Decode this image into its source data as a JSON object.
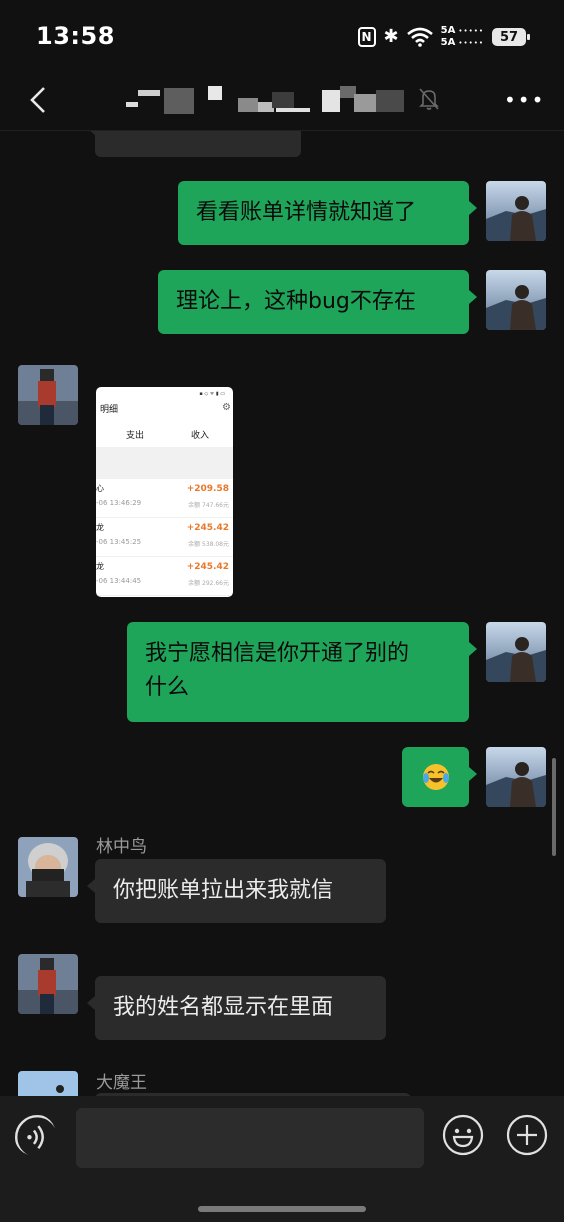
{
  "status_bar": {
    "time": "13:58",
    "network_label_top": "5A",
    "network_label_bottom": "5A",
    "battery": "57",
    "icons": [
      "nfc-icon",
      "bluetooth-icon",
      "wifi-icon",
      "signal-icon",
      "battery-icon"
    ]
  },
  "nav": {
    "back_icon": "chevron-left-icon",
    "mute_icon": "bell-off-icon",
    "more_icon": "more-horizontal-icon"
  },
  "messages": [
    {
      "from": "me",
      "text": "看看账单详情就知道了"
    },
    {
      "from": "me",
      "text": "理论上，这种bug不存在"
    },
    {
      "from": "other",
      "type": "image"
    },
    {
      "from": "me",
      "text_line1": "我宁愿相信是你开通了别的",
      "text_line2": "什么"
    },
    {
      "from": "me",
      "type": "emoji",
      "emoji": "laughing-with-tears-emoji"
    },
    {
      "from": "other",
      "sender": "林中鸟",
      "text": "你把账单拉出来我就信"
    },
    {
      "from": "other",
      "text": "我的姓名都显示在里面"
    },
    {
      "from": "other",
      "sender": "大魔王"
    }
  ],
  "screenshot_image": {
    "header": "明细",
    "tab_expense": "支出",
    "tab_income": "收入",
    "rows": [
      {
        "name": "心",
        "date": "-06 13:46:29",
        "amount": "+209.58",
        "balance": "余额 747.66元"
      },
      {
        "name": "龙",
        "date": "-06 13:45:25",
        "amount": "+245.42",
        "balance": "余额 538.08元"
      },
      {
        "name": "龙",
        "date": "-06 13:44:45",
        "amount": "+245.42",
        "balance": "余额 292.66元"
      }
    ]
  },
  "input_bar": {
    "placeholder": "",
    "icons": [
      "voice-icon",
      "emoji-icon",
      "plus-icon"
    ]
  },
  "colors": {
    "background": "#111111",
    "outgoing_bubble": "#1ea55a",
    "incoming_bubble": "#2b2b2b",
    "amount_orange": "#e8782a"
  }
}
